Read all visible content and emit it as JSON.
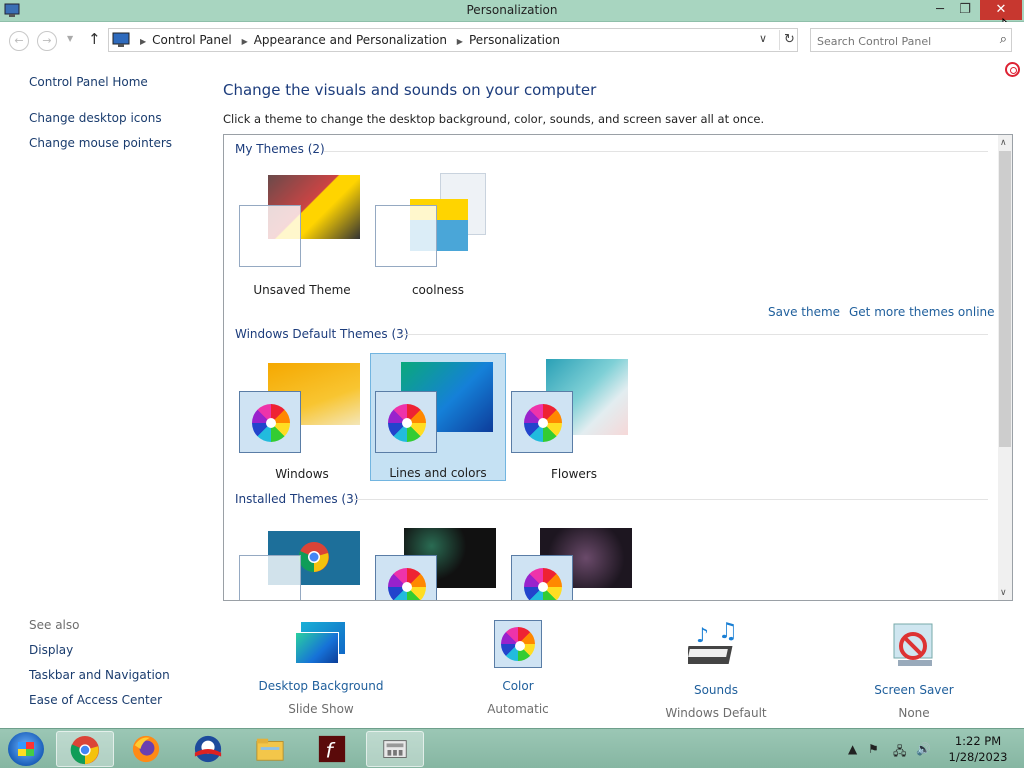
{
  "window": {
    "title": "Personalization",
    "minimize": "─",
    "maximize": "❐",
    "close": "✕"
  },
  "nav": {
    "back": "←",
    "forward": "→",
    "up": "↑",
    "breadcrumbs": [
      "Control Panel",
      "Appearance and Personalization",
      "Personalization"
    ],
    "search_placeholder": "Search Control Panel"
  },
  "sidebar": {
    "home": "Control Panel Home",
    "links": [
      "Change desktop icons",
      "Change mouse pointers"
    ],
    "see_also_label": "See also",
    "see_also": [
      "Display",
      "Taskbar and Navigation",
      "Ease of Access Center"
    ]
  },
  "main": {
    "title": "Change the visuals and sounds on your computer",
    "description": "Click a theme to change the desktop background, color, sounds, and screen saver all at once."
  },
  "groups": {
    "my": {
      "label": "My Themes (2)",
      "themes": [
        "Unsaved Theme",
        "coolness"
      ]
    },
    "actions": {
      "save": "Save theme",
      "more": "Get more themes online"
    },
    "default": {
      "label": "Windows Default Themes (3)",
      "themes": [
        "Windows",
        "Lines and colors",
        "Flowers"
      ],
      "selected": "Lines and colors"
    },
    "installed": {
      "label": "Installed Themes (3)"
    }
  },
  "bottom": [
    {
      "name": "Desktop Background",
      "value": "Slide Show"
    },
    {
      "name": "Color",
      "value": "Automatic"
    },
    {
      "name": "Sounds",
      "value": "Windows Default"
    },
    {
      "name": "Screen Saver",
      "value": "None"
    }
  ],
  "taskbar": {
    "time": "1:22 PM",
    "date": "1/28/2023",
    "apps": [
      "chrome-icon",
      "firefox-icon",
      "obama-logo-icon",
      "file-explorer-icon",
      "flash-icon",
      "control-panel-icon"
    ]
  },
  "colors": {
    "titlebar": "#a8d5c0",
    "close": "#c7372f",
    "link": "#1f5f9c",
    "heading": "#1c3c7c",
    "selected": "#c5e1f3"
  }
}
